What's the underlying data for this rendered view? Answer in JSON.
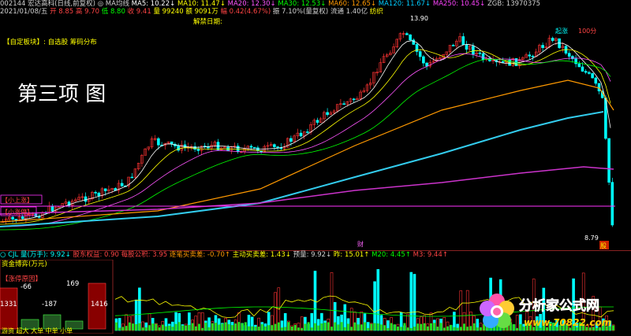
{
  "header": {
    "row1": [
      {
        "text": "002144 宏达高科(日线,前复权)",
        "color": "#d0d0d0"
      },
      {
        "text": "◎ MA均线",
        "color": "#d0d0d0"
      },
      {
        "text": "MA5: 10.22↓",
        "color": "#ffffff"
      },
      {
        "text": "MA10: 11.47↓",
        "color": "#ffff00"
      },
      {
        "text": "MA20: 12.30↓",
        "color": "#ff55ff"
      },
      {
        "text": "MA30: 12.53↓",
        "color": "#00ff00"
      },
      {
        "text": "MA60: 12.65↓",
        "color": "#ff9900"
      },
      {
        "text": "MA120: 11.67↓",
        "color": "#00ccff"
      },
      {
        "text": "MA250: 10.45↓",
        "color": "#ff44ff"
      },
      {
        "text": "ZGB: 13970375",
        "color": "#d0d0d0"
      }
    ],
    "row2": [
      {
        "text": "2021/01/08/五",
        "color": "#d0d0d0"
      },
      {
        "text": "开 8.85",
        "color": "#ff4444"
      },
      {
        "text": "高 9.70",
        "color": "#ff4444"
      },
      {
        "text": "低 8.80",
        "color": "#00ff00"
      },
      {
        "text": "收 9.41",
        "color": "#ff4444"
      },
      {
        "text": "量 99240",
        "color": "#ffff00"
      },
      {
        "text": "额 9091万",
        "color": "#ffff00"
      },
      {
        "text": "幅 0.42(4.67%)",
        "color": "#ff4444"
      },
      {
        "text": "振 7.10%(量复权)",
        "color": "#d0d0d0"
      },
      {
        "text": "流通 1.40亿",
        "color": "#d0d0d0"
      },
      {
        "text": "纺织",
        "color": "#ffff00"
      }
    ]
  },
  "panel": {
    "board_label": "【自定板块】: 自选股 筹码分布",
    "unlock_label": "解禁日期:",
    "big_title": "第三项  图",
    "high_label": "13.90",
    "low_label": "8.79",
    "alert_label": "起涨",
    "alert_value": "100分",
    "side_label_1": "【小上涨】",
    "side_label_2": "【小涨停】",
    "fin_label": "财",
    "event_label": "股"
  },
  "indicator": {
    "row": [
      {
        "text": "○ CJL 量(万手): 9.92↓",
        "color": "#00ffff"
      },
      {
        "text": "股东权益: 0.90",
        "color": "#ff4444"
      },
      {
        "text": "每股公积: 3.95",
        "color": "#ff4444"
      },
      {
        "text": "逐笔买卖差: -0.70↑",
        "color": "#ff9900"
      },
      {
        "text": "主动买卖差: 1.43↓",
        "color": "#ffff00"
      },
      {
        "text": "预量: 9.92↓",
        "color": "#d0d0d0"
      },
      {
        "text": "昨: 15.01↑",
        "color": "#ffff00"
      },
      {
        "text": "M20: 4.45↑",
        "color": "#00ff00"
      },
      {
        "text": "M3: 9.44↑",
        "color": "#ff4444"
      }
    ],
    "fund_title": "资金博弈(万元)",
    "fund_sub": "【涨停原因】",
    "fund_values": [
      "-66",
      "169",
      "1331",
      "-187",
      "1416"
    ],
    "fund_footer": "游资  超大  大单  中单  小单"
  },
  "watermark": {
    "text_main": "分析家公式网",
    "text_url": "www.70822.com"
  },
  "colors": {
    "up": "#ff3333",
    "down": "#00ffff",
    "ma5": "#ffffff",
    "ma10": "#ffff00",
    "ma20": "#ff55ff",
    "ma30": "#00ff00",
    "ma60": "#ff9900",
    "ma120": "#33ccee",
    "ma250": "#cc33cc"
  }
}
